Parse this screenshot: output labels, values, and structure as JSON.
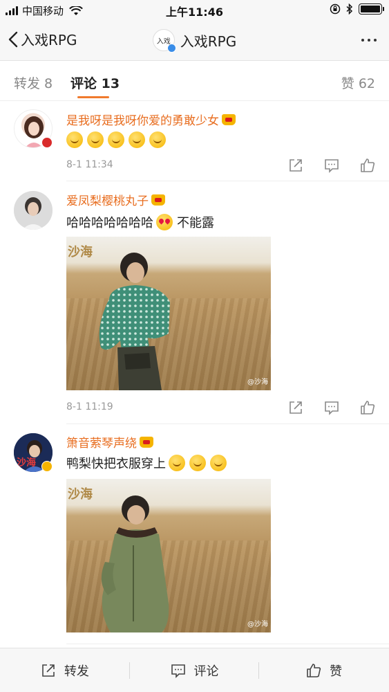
{
  "status_bar": {
    "carrier": "中国移动",
    "time": "上午11:46"
  },
  "nav": {
    "back_label": "入戏RPG",
    "avatar_text": "入戏",
    "title": "入戏RPG"
  },
  "tabs": {
    "repost": "转发 8",
    "comment": "评论 13",
    "like": "赞 62"
  },
  "comments": [
    {
      "username": "是我呀是我呀你爱的勇敢少女",
      "text": "",
      "emoji_count": 5,
      "time": "8-1 11:34",
      "has_photo": false
    },
    {
      "username": "爱凤梨樱桃丸子",
      "text_before": "哈哈哈哈哈哈哈",
      "text_after": "不能露",
      "time": "8-1 11:19",
      "photo_logo": "沙海",
      "photo_watermark": "@沙海"
    },
    {
      "username": "箫音萦琴声绕",
      "text": "鸭梨快把衣服穿上",
      "emoji_count": 3,
      "avatar_text": "沙海",
      "photo_logo": "沙海",
      "photo_watermark": "@沙海"
    }
  ],
  "bottom_bar": {
    "repost": "转发",
    "comment": "评论",
    "like": "赞"
  },
  "colors": {
    "accent": "#f07a2d",
    "username": "#e86d1f"
  }
}
